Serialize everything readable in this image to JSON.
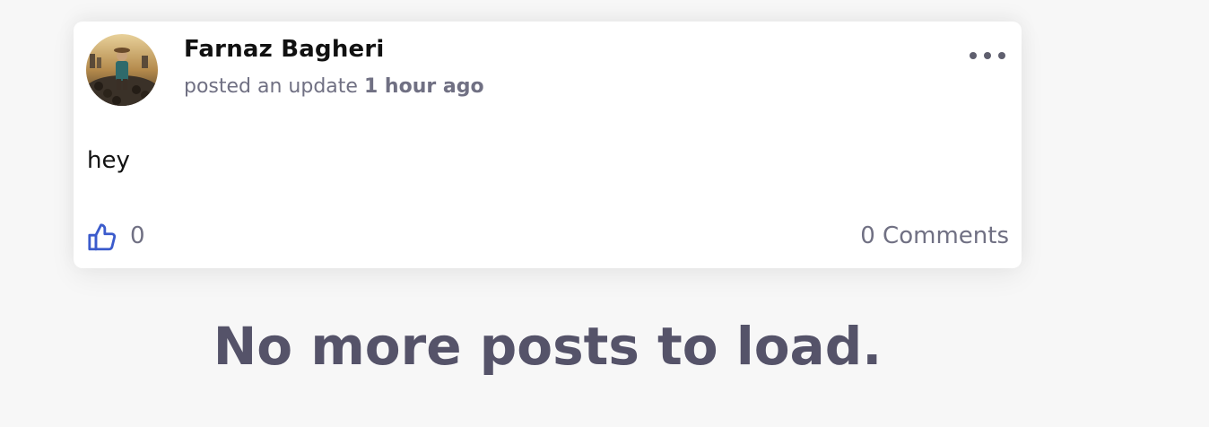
{
  "post": {
    "author": "Farnaz Bagheri",
    "action_text": "posted an update",
    "time": "1 hour ago",
    "body": "hey",
    "like_count": "0",
    "comments_label": "0 Comments"
  },
  "feed": {
    "end_message": "No more posts to load."
  },
  "icons": {
    "avatar": "user-avatar-photo",
    "more": "more-options-dots-icon",
    "like": "thumbs-up-icon"
  },
  "colors": {
    "background": "#f7f7f7",
    "card": "#ffffff",
    "muted_text": "#707083",
    "like_accent": "#3b5bcc",
    "end_message": "#555369"
  }
}
